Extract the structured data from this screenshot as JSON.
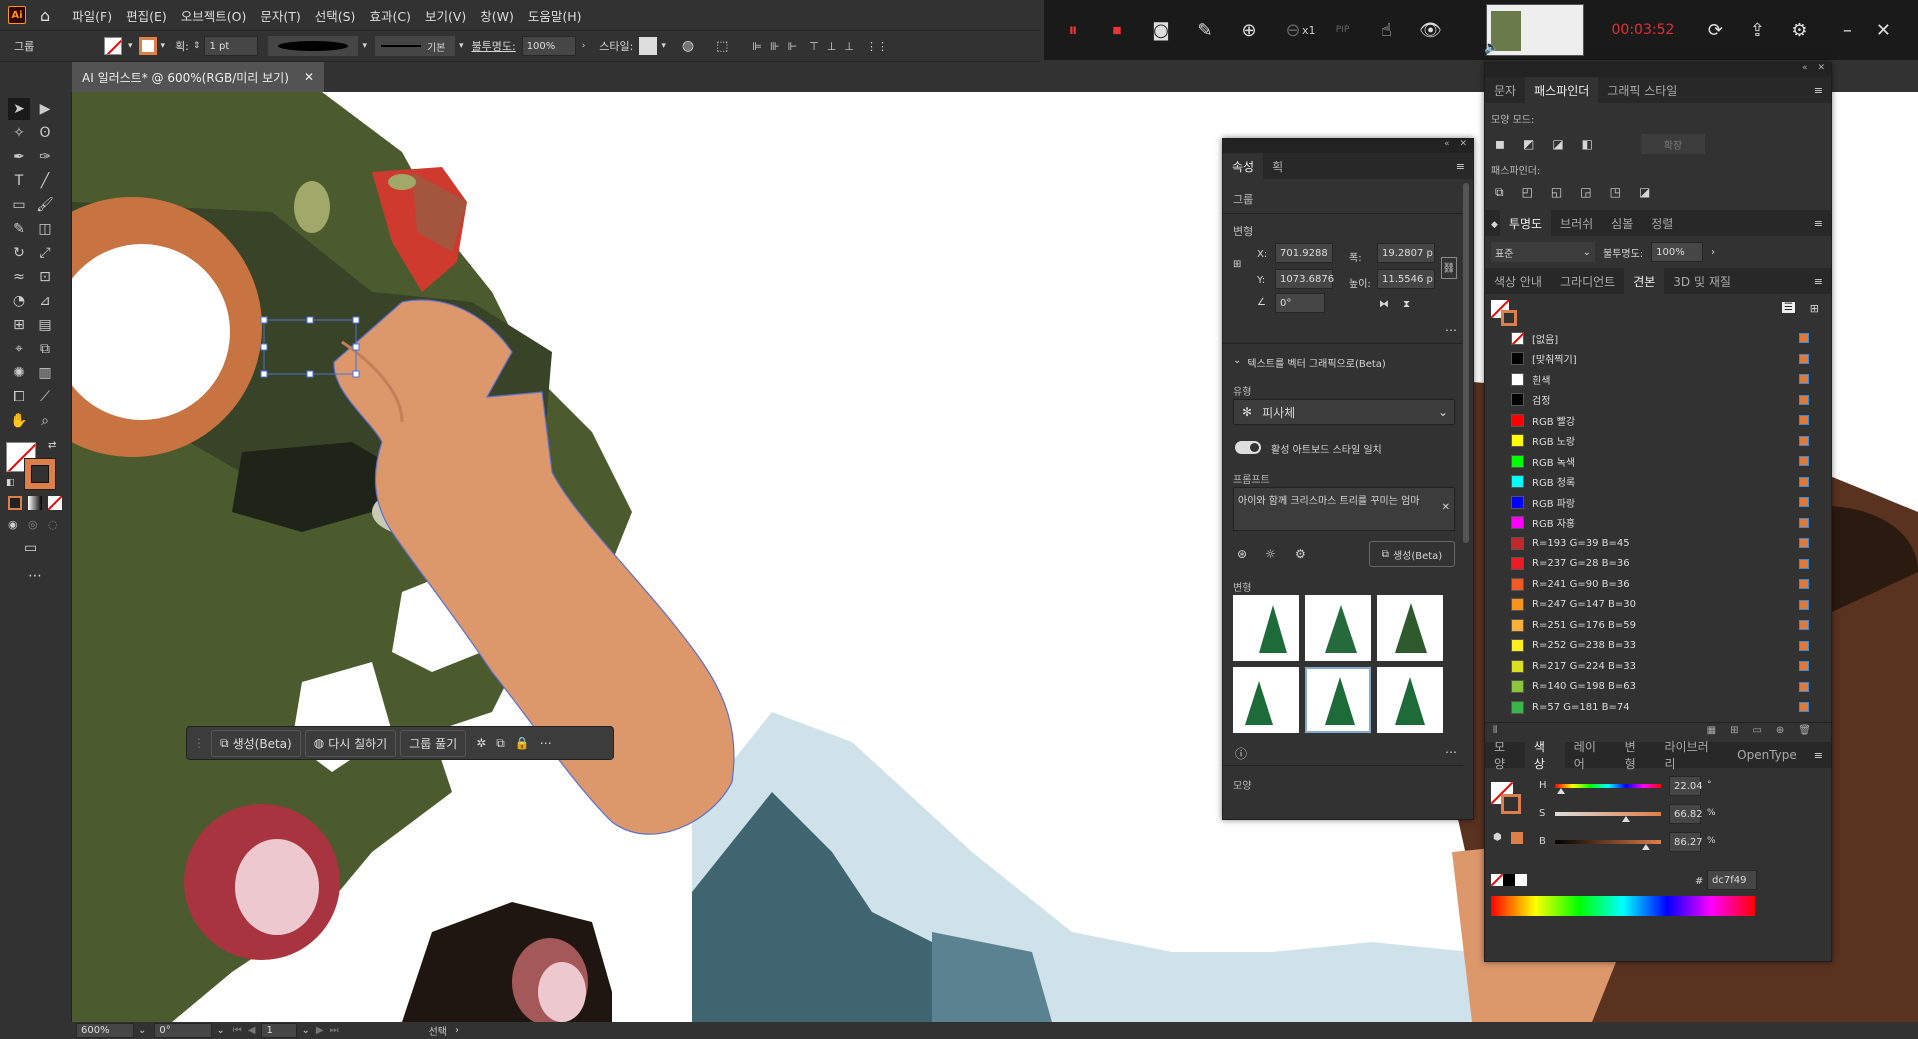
{
  "menu": [
    "파일(F)",
    "편집(E)",
    "오브젝트(O)",
    "문자(T)",
    "선택(S)",
    "효과(C)",
    "보기(V)",
    "창(W)",
    "도움말(H)"
  ],
  "ctrl": {
    "group": "그룹",
    "stroke_label": "획:",
    "stroke_val": "1 pt",
    "brush": "기본",
    "opacity_label": "불투명도:",
    "opacity": "100%",
    "style_label": "스타일:"
  },
  "doctab": "AI 일러스트* @ 600%(RGB/미리 보기)",
  "recorder": {
    "time": "00:03:52",
    "zoom": "x1"
  },
  "context_bar": {
    "generate": "생성(Beta)",
    "recolor": "다시 칠하기",
    "ungroup": "그룹 풀기"
  },
  "props": {
    "tabs": [
      "속성",
      "획"
    ],
    "type": "그룹",
    "transform": "변형",
    "x_label": "X:",
    "x": "701.9288",
    "y_label": "Y:",
    "y": "1073.6876",
    "w_label": "폭:",
    "w": "19.2807 p",
    "h_label": "높이:",
    "h": "11.5546 p",
    "angle": "0°",
    "t2v": "텍스트를 벡터 그래픽으로(Beta)",
    "type_label": "유형",
    "subject": "피사체",
    "match_label": "활성 아트보드 스타일 일치",
    "prompt_label": "프롬프트",
    "prompt": "아이와 함께 크리스마스 트리를 꾸미는 엄마",
    "gen_btn": "생성(Beta)",
    "variants_label": "변형",
    "appearance": "모양"
  },
  "pathfinder": {
    "tabs": [
      "문자",
      "패스파인더",
      "그래픽 스타일"
    ],
    "shape_modes": "모양 모드:",
    "expand": "확장",
    "pathfinders": "패스파인더:"
  },
  "transparency": {
    "tabs": [
      "투명도",
      "브러쉬",
      "심볼",
      "정렬"
    ],
    "mode": "표준",
    "opacity_label": "불투명도:",
    "opacity": "100%"
  },
  "swatches": {
    "tabs": [
      "색상 안내",
      "그라디언트",
      "견본",
      "3D 및 재질"
    ],
    "items": [
      {
        "name": "[없음]",
        "color": "none"
      },
      {
        "name": "[맞춰찍기]",
        "color": "#000000"
      },
      {
        "name": "흰색",
        "color": "#ffffff"
      },
      {
        "name": "검정",
        "color": "#000000"
      },
      {
        "name": "RGB 빨강",
        "color": "#ff0000"
      },
      {
        "name": "RGB 노랑",
        "color": "#ffff00"
      },
      {
        "name": "RGB 녹색",
        "color": "#00ff00"
      },
      {
        "name": "RGB 청록",
        "color": "#00ffff"
      },
      {
        "name": "RGB 파랑",
        "color": "#0000ff"
      },
      {
        "name": "RGB 자홍",
        "color": "#ff00ff"
      },
      {
        "name": "R=193 G=39 B=45",
        "color": "#c1272d"
      },
      {
        "name": "R=237 G=28 B=36",
        "color": "#ed1c24"
      },
      {
        "name": "R=241 G=90 B=36",
        "color": "#f15a24"
      },
      {
        "name": "R=247 G=147 B=30",
        "color": "#f7931e"
      },
      {
        "name": "R=251 G=176 B=59",
        "color": "#fbb03b"
      },
      {
        "name": "R=252 G=238 B=33",
        "color": "#fcee21"
      },
      {
        "name": "R=217 G=224 B=33",
        "color": "#d9e021"
      },
      {
        "name": "R=140 G=198 B=63",
        "color": "#8cc63f"
      },
      {
        "name": "R=57 G=181 B=74",
        "color": "#39b54a"
      }
    ]
  },
  "color": {
    "tabs": [
      "모양",
      "색상",
      "레이어",
      "변형",
      "라이브러리",
      "OpenType"
    ],
    "h": "22.04",
    "h_unit": "°",
    "s": "66.82",
    "s_unit": "%",
    "b": "86.27",
    "b_unit": "%",
    "hex_label": "#",
    "hex": "dc7f49",
    "fill_color": "#dc7f49",
    "h_pos": 0.06,
    "s_pos": 0.668,
    "b_pos": 0.863
  },
  "status": {
    "zoom": "600%",
    "angle": "0°",
    "page": "1",
    "mode": "선택"
  }
}
